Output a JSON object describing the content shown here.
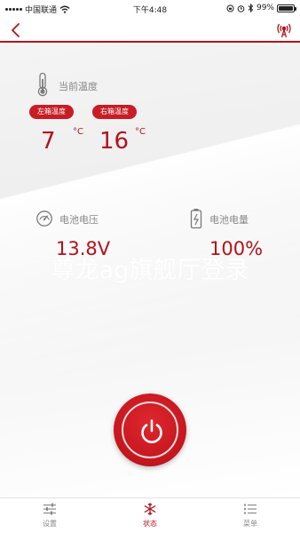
{
  "status_bar": {
    "carrier": "中国联通",
    "time": "下午4:48",
    "battery": "99%",
    "battery_level": 0.99,
    "icons": [
      "signal-dots-icon",
      "wifi-icon",
      "lock-rotation-icon",
      "alarm-icon",
      "bluetooth-icon",
      "battery-icon"
    ]
  },
  "nav": {
    "back_icon": "chevron-left-icon",
    "right_icon": "broadcast-signal-icon"
  },
  "temperature": {
    "title": "当前温度",
    "left_label": "左箱温度",
    "right_label": "右箱温度",
    "left_value": "7",
    "right_value": "16",
    "unit": "°C"
  },
  "battery": {
    "voltage_title": "电池电压",
    "voltage_value": "13.8V",
    "level_title": "电池电量",
    "level_value": "100%"
  },
  "watermark": "尊龙ag旗舰厅登录",
  "power": {
    "icon": "power-icon"
  },
  "tabs": [
    {
      "label": "设置",
      "icon": "sliders-icon"
    },
    {
      "label": "状态",
      "icon": "snowflake-icon"
    },
    {
      "label": "菜单",
      "icon": "list-icon"
    }
  ],
  "colors": {
    "accent": "#b5121b",
    "button": "#c81d25"
  }
}
